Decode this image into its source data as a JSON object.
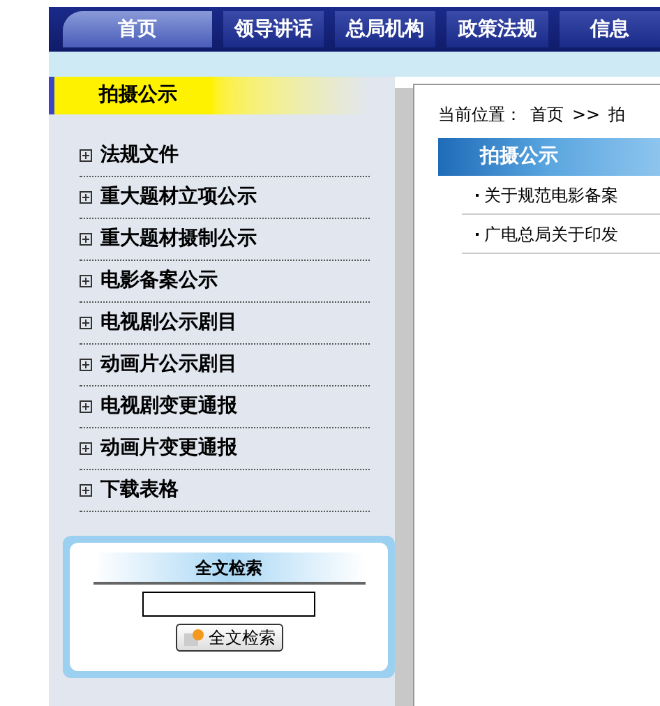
{
  "nav": [
    {
      "label": "首页",
      "selected": true
    },
    {
      "label": "领导讲话",
      "selected": false
    },
    {
      "label": "总局机构",
      "selected": false
    },
    {
      "label": "政策法规",
      "selected": false
    },
    {
      "label": "信息",
      "selected": false
    }
  ],
  "sidebar": {
    "title": "拍摄公示",
    "items": [
      "法规文件",
      "重大题材立项公示",
      "重大题材摄制公示",
      "电影备案公示",
      "电视剧公示剧目",
      "动画片公示剧目",
      "电视剧变更通报",
      "动画片变更通报",
      "下载表格"
    ],
    "search": {
      "title": "全文检索",
      "button": "全文检索"
    }
  },
  "breadcrumb": {
    "label": "当前位置：",
    "home": "首页",
    "separator": ">>",
    "current": "拍"
  },
  "content": {
    "title": "拍摄公示",
    "items": [
      "关于规范电影备案",
      "广电总局关于印发"
    ]
  }
}
